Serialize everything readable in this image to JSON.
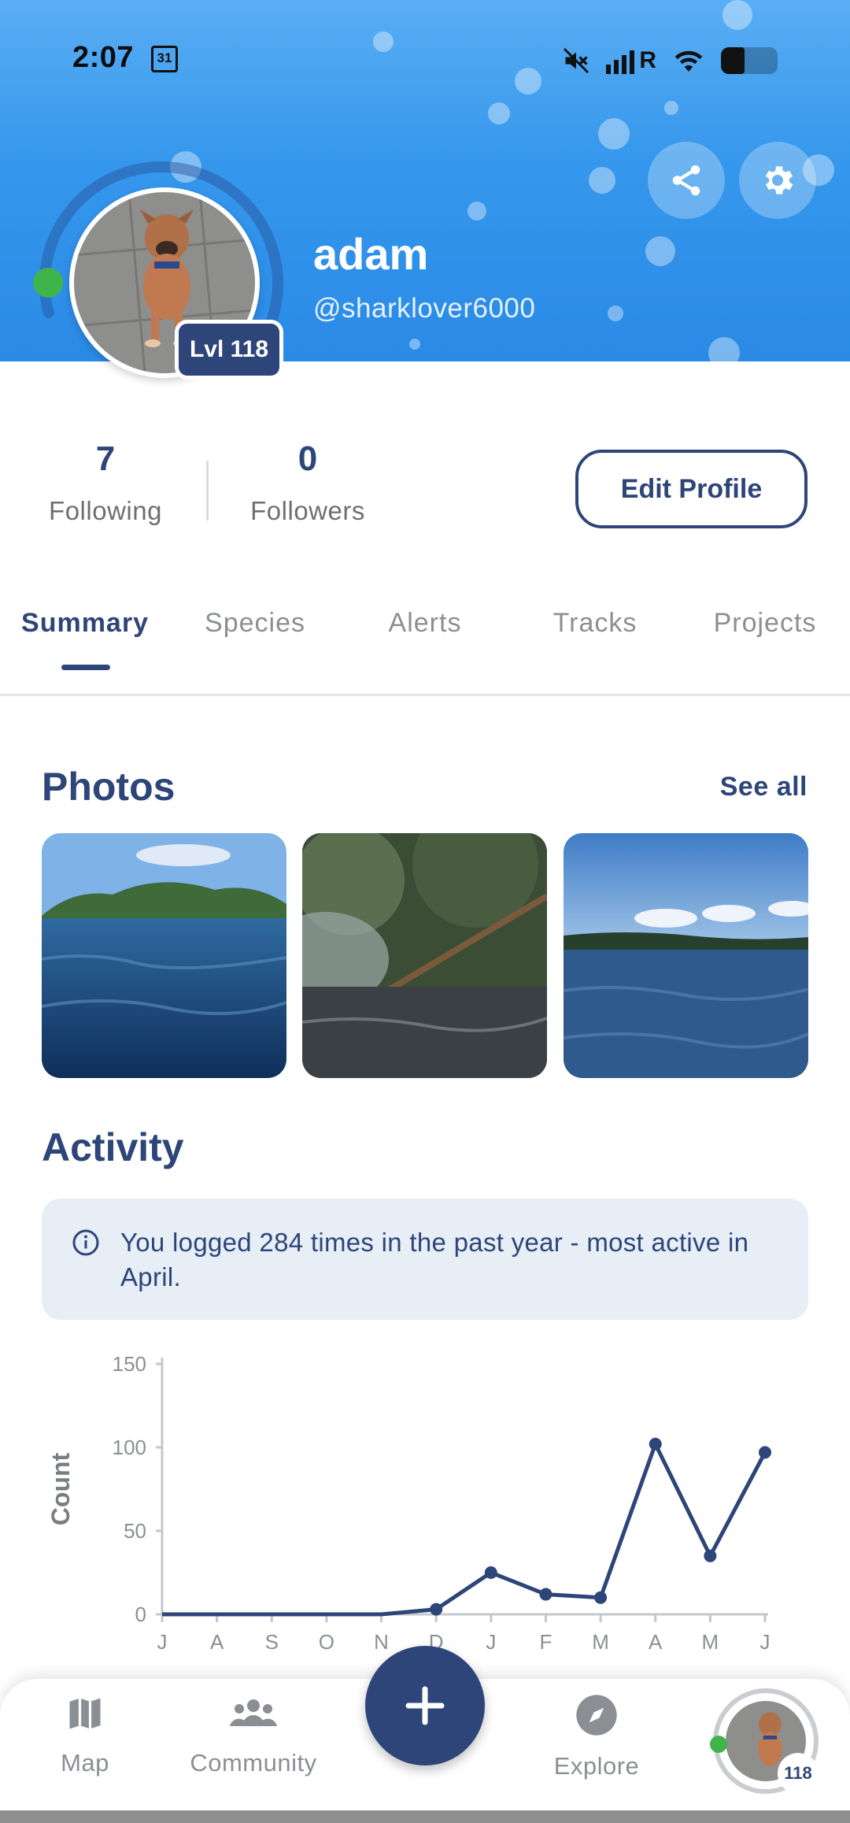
{
  "status_bar": {
    "time": "2:07",
    "calendar_day": "31",
    "network": "R"
  },
  "profile": {
    "name": "adam",
    "handle": "@sharklover6000",
    "level_label": "Lvl 118",
    "level_progress": 0.75
  },
  "stats": {
    "following_count": "7",
    "following_label": "Following",
    "followers_count": "0",
    "followers_label": "Followers",
    "edit_label": "Edit Profile"
  },
  "tabs": [
    {
      "label": "Summary",
      "active": true
    },
    {
      "label": "Species"
    },
    {
      "label": "Alerts"
    },
    {
      "label": "Tracks"
    },
    {
      "label": "Projects"
    }
  ],
  "photos": {
    "title": "Photos",
    "see_all": "See all",
    "items": [
      {
        "icon": "lake-island-photo"
      },
      {
        "icon": "fallen-tree-photo"
      },
      {
        "icon": "open-water-photo"
      }
    ]
  },
  "activity": {
    "title": "Activity",
    "info": "You logged 284 times in the past year - most active in April."
  },
  "chart_data": {
    "type": "line",
    "title": "",
    "xlabel": "",
    "ylabel": "Count",
    "categories": [
      "J",
      "A",
      "S",
      "O",
      "N",
      "D",
      "J",
      "F",
      "M",
      "A",
      "M",
      "J"
    ],
    "series": [
      {
        "values": [
          0,
          0,
          0,
          0,
          0,
          3,
          25,
          12,
          10,
          102,
          35,
          97
        ]
      }
    ],
    "yticks": [
      0,
      50,
      100,
      150
    ],
    "ylim": [
      0,
      150
    ],
    "grid": false,
    "color": "#2d4578"
  },
  "nav": {
    "map": "Map",
    "community": "Community",
    "explore": "Explore",
    "avatar_level": "118"
  },
  "colors": {
    "primary": "#2d4578",
    "header_blue": "#3597ec",
    "online": "#3fb44a",
    "info_bg": "#e7eef6"
  }
}
